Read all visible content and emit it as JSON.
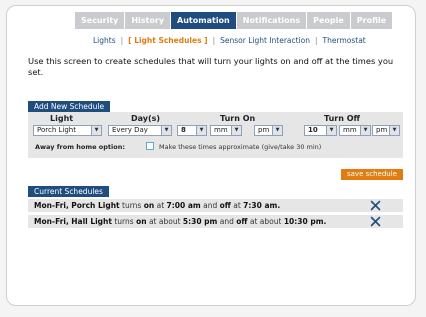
{
  "tabs": [
    {
      "label": "Security",
      "active": false
    },
    {
      "label": "History",
      "active": false
    },
    {
      "label": "Automation",
      "active": true
    },
    {
      "label": "Notifications",
      "active": false
    },
    {
      "label": "People",
      "active": false
    },
    {
      "label": "Profile",
      "active": false
    }
  ],
  "subnav": {
    "lights": "Lights",
    "light_schedules": "[ Light Schedules ]",
    "sensor": "Sensor Light Interaction",
    "thermostat": "Thermostat"
  },
  "intro": "Use this screen to create schedules that will turn your lights on and off at the times you set.",
  "add": {
    "title": "Add New Schedule",
    "col_light": "Light",
    "col_days": "Day(s)",
    "col_on": "Turn On",
    "col_off": "Turn Off",
    "light": "Porch Light",
    "days": "Every Day",
    "on_hour": "8",
    "on_min": "mm",
    "on_ampm": "pm",
    "off_hour": "10",
    "off_min": "mm",
    "off_ampm": "pm",
    "away_label": "Away from home option:",
    "away_text": "Make these times approximate (give/take 30 min)"
  },
  "save_label": "save schedule",
  "current": {
    "title": "Current Schedules",
    "rows": [
      {
        "days": "Mon-Fri,",
        "light": "Porch Light",
        "t1": "turns",
        "on": "on",
        "at1": "at",
        "on_time": "7:00 am",
        "and": "and",
        "off": "off",
        "at2": "at",
        "off_time": "7:30 am."
      },
      {
        "days": "Mon-Fri,",
        "light": "Hall Light",
        "t1": "turns",
        "on": "on",
        "at1": "at about",
        "on_time": "5:30 pm",
        "and": "and",
        "off": "off",
        "at2": "at about",
        "off_time": "10:30 pm."
      }
    ]
  },
  "colors": {
    "tab_active": "#1f4d7f",
    "tab_inactive": "#c9cbcf",
    "accent_orange": "#e07d10",
    "delete_x": "#1f4d7f"
  }
}
